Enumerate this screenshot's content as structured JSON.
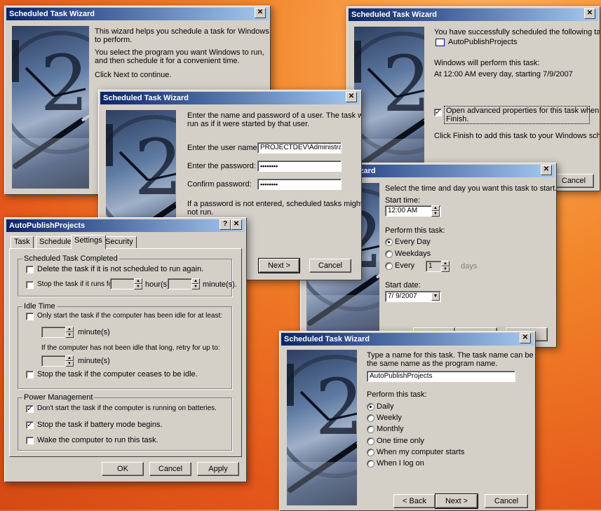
{
  "wizard_intro": {
    "title": "Scheduled Task Wizard",
    "line1": "This wizard helps you schedule a task for Windows",
    "line2": "to perform.",
    "line3": "You select the program you want Windows to run,",
    "line4": "and then schedule it for a convenient time.",
    "line5": "Click Next to continue."
  },
  "wizard_finish": {
    "title": "Scheduled Task Wizard",
    "success": "You have successfully scheduled the following task:",
    "task_name": "AutoPublishProjects",
    "perform_label": "Windows will perform this task:",
    "perform_value": "At 12:00 AM every day, starting 7/9/2007",
    "advanced_line1": "Open advanced properties for this task when I click",
    "advanced_line2": "Finish.",
    "click_finish": "Click Finish to add this task to your Windows schedule.",
    "cancel_label": "Cancel"
  },
  "wizard_login": {
    "title": "Scheduled Task Wizard",
    "instr1": "Enter the name and password of a user.  The task will",
    "instr2": "run as if it were started by that user.",
    "user_label": "Enter the user name:",
    "user_value": "PROJECTDEV\\Administrato",
    "pass_label": "Enter the password:",
    "pass_value": "••••••••",
    "confirm_label": "Confirm password:",
    "confirm_value": "••••••••",
    "note1": "If a password is not entered, scheduled tasks might",
    "note2": "not run.",
    "next_label": "Next >",
    "cancel_label": "Cancel"
  },
  "wizard_time": {
    "title_partial": "zard",
    "instr": "Select the time and day you want this task to start.",
    "start_time_label": "Start time:",
    "start_time_value": "12:00 AM",
    "perform_label": "Perform this task:",
    "opt_every_day": "Every Day",
    "opt_weekdays": "Weekdays",
    "opt_every": "Every",
    "every_value": "1",
    "days_label": "days",
    "start_date_label": "Start date:",
    "start_date_value": "7/ 9/2007"
  },
  "props": {
    "title": "AutoPublishProjects",
    "help_btn": "?",
    "tabs": [
      "Task",
      "Schedule",
      "Settings",
      "Security"
    ],
    "group_completed": "Scheduled Task Completed",
    "delete_label": "Delete the task if it is not scheduled to run again.",
    "stop_label": "Stop the task if it runs for:",
    "hours_label": "hour(s)",
    "minutes_label": "minute(s).",
    "group_idle": "Idle Time",
    "idle_only": "Only start the task if the computer has been idle for at least:",
    "idle_minutes": "minute(s)",
    "idle_retry": "If the computer has not been idle that long, retry for up to:",
    "retry_minutes": "minute(s)",
    "idle_stop": "Stop the task if the computer ceases to be idle.",
    "group_power": "Power Management",
    "battery_dont": "Don't start the task if the computer is running on batteries.",
    "battery_stop": "Stop the task if battery mode begins.",
    "wake": "Wake the computer to run this task.",
    "ok_label": "OK",
    "cancel_label": "Cancel",
    "apply_label": "Apply"
  },
  "wizard_name": {
    "title": "Scheduled Task Wizard",
    "instr1": "Type a name for this task.  The task name can be",
    "instr2": "the same name as the program name.",
    "name_value": "AutoPublishProjects",
    "perform_label": "Perform this task:",
    "options": [
      "Daily",
      "Weekly",
      "Monthly",
      "One time only",
      "When my computer starts",
      "When I log on"
    ],
    "back_label": "< Back",
    "next_label": "Next >",
    "cancel_label": "Cancel"
  },
  "close_glyph": "✕"
}
